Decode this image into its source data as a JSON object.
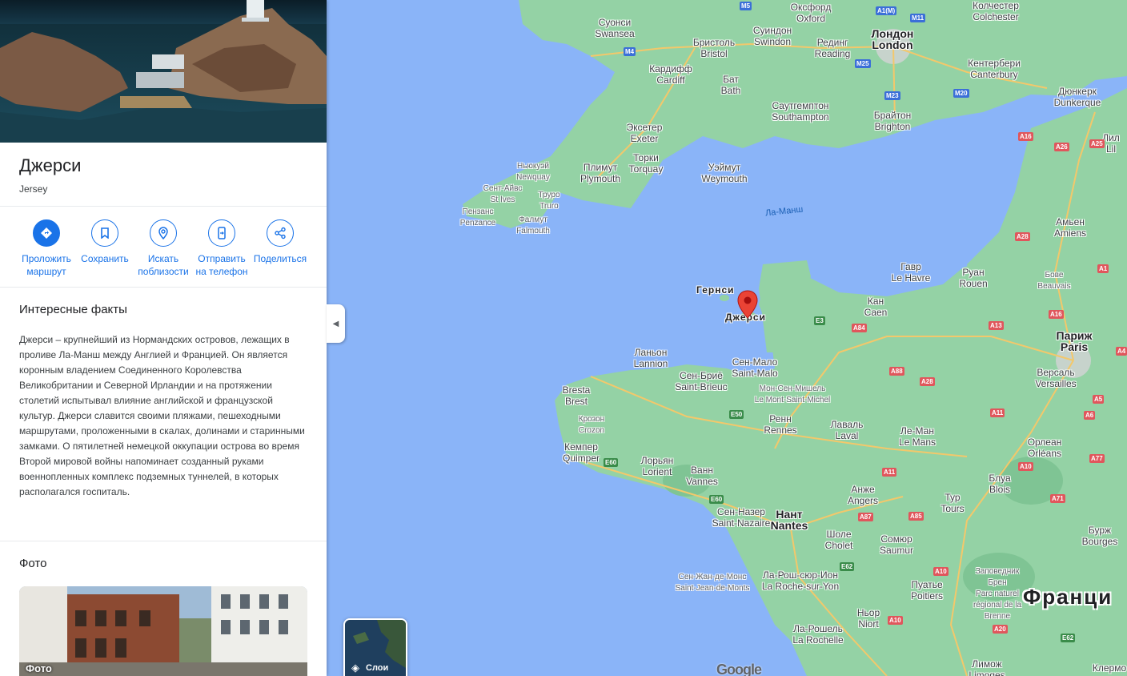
{
  "place": {
    "title": "Джерси",
    "subtitle": "Jersey"
  },
  "actions": [
    {
      "label": "Проложить маршрут",
      "icon": "directions-icon"
    },
    {
      "label": "Сохранить",
      "icon": "bookmark-icon"
    },
    {
      "label": "Искать поблизости",
      "icon": "nearby-search-icon"
    },
    {
      "label": "Отправить на телефон",
      "icon": "send-to-phone-icon"
    },
    {
      "label": "Поделиться",
      "icon": "share-icon"
    }
  ],
  "facts": {
    "title": "Интересные факты",
    "text": "Джерси – крупнейший из Нормандских островов, лежащих в проливе Ла-Манш между Англией и Францией. Он является коронным владением Соединенного Королевства Великобритании и Северной Ирландии и на протяжении столетий испытывал влияние английской и французской культур. Джерси славится своими пляжами, пешеходными маршрутами, проложенными в скалах, долинами и старинными замками. О пятилетней немецкой оккупации острова во время Второй мировой войны напоминает созданный руками военнопленных комплекс подземных туннелей, в которых располагался госпиталь."
  },
  "photos": {
    "title": "Фото",
    "card_label": "Фото"
  },
  "map": {
    "layers_label": "Слои",
    "google_logo": "Google",
    "country_label": "Франци",
    "water_label": "Ла-Манш",
    "islands": {
      "guernsey": "Гернси",
      "jersey": "Джерси"
    },
    "cities": {
      "swansea": [
        "Суонси",
        "Swansea"
      ],
      "oxford": [
        "Оксфорд",
        "Oxford"
      ],
      "colchester": [
        "Колчестер",
        "Colchester"
      ],
      "bristol": [
        "Бристоль",
        "Bristol"
      ],
      "swindon": [
        "Суиндон",
        "Swindon"
      ],
      "reading": [
        "Рединг",
        "Reading"
      ],
      "london": [
        "Лондон",
        "London"
      ],
      "cardiff": [
        "Кардифф",
        "Cardiff"
      ],
      "bath": [
        "Бат",
        "Bath"
      ],
      "canterbury": [
        "Кентербери",
        "Canterbury"
      ],
      "dunkerque": [
        "Дюнкерк",
        "Dunkerque"
      ],
      "southampton": [
        "Саутгемптон",
        "Southampton"
      ],
      "brighton": [
        "Брайтон",
        "Brighton"
      ],
      "exeter": [
        "Экcетер",
        "Exeter"
      ],
      "torquay": [
        "Торки",
        "Torquay"
      ],
      "plymouth": [
        "Плимут",
        "Plymouth"
      ],
      "weymouth": [
        "Уэймут",
        "Weymouth"
      ],
      "newquay": [
        "Ньюкуэй",
        "Newquay"
      ],
      "st_ives": [
        "Сент-Айвс",
        "St Ives"
      ],
      "truro": [
        "Труро",
        "Truro"
      ],
      "penzance": [
        "Пензанс",
        "Penzance"
      ],
      "falmouth": [
        "Фалмут",
        "Falmouth"
      ],
      "lille": [
        "Лил",
        "Lil"
      ],
      "amiens": [
        "Амьен",
        "Amiens"
      ],
      "le_havre": [
        "Гавр",
        "Le Havre"
      ],
      "rouen": [
        "Руан",
        "Rouen"
      ],
      "beauvais": [
        "Бове",
        "Beauvais"
      ],
      "caen": [
        "Кан",
        "Caen"
      ],
      "paris": [
        "Париж",
        "Paris"
      ],
      "versailles": [
        "Версаль",
        "Versailles"
      ],
      "lannion": [
        "Ланьон",
        "Lannion"
      ],
      "saint_malo": [
        "Сен-Мало",
        "Saint-Malo"
      ],
      "saint_brieuc": [
        "Сен-Бриё",
        "Saint-Brieuc"
      ],
      "mont_saint_michel": [
        "Мон-Сен-Мишель",
        "Le Mont-Saint-Michel"
      ],
      "brest": [
        "Bresta",
        "Brest"
      ],
      "crozon": [
        "Крозон",
        "Crozon"
      ],
      "rennes": [
        "Ренн",
        "Rennes"
      ],
      "laval": [
        "Лаваль",
        "Laval"
      ],
      "le_mans": [
        "Ле-Ман",
        "Le Mans"
      ],
      "quimper": [
        "Кемпер",
        "Quimper"
      ],
      "lorient": [
        "Лорьян",
        "Lorient"
      ],
      "orleans": [
        "Орлеан",
        "Orléans"
      ],
      "vannes": [
        "Ванн",
        "Vannes"
      ],
      "angers": [
        "Анже",
        "Angers"
      ],
      "blois": [
        "Блуа",
        "Blois"
      ],
      "saint_nazaire": [
        "Сен-Назер",
        "Saint-Nazaire"
      ],
      "nantes": [
        "Нант",
        "Nantes"
      ],
      "tours": [
        "Тур",
        "Tours"
      ],
      "cholet": [
        "Шоле",
        "Cholet"
      ],
      "saumur": [
        "Сомюр",
        "Saumur"
      ],
      "bourges": [
        "Бурж",
        "Bourges"
      ],
      "saint_jean_de_monts": [
        "Сен-Жан-де-Монс",
        "Saint-Jean-de-Monts"
      ],
      "la_roche_sur_yon": [
        "Ла-Рош-сюр-Ион",
        "La Roche-sur-Yon"
      ],
      "poitiers": [
        "Пуатье",
        "Poitiers"
      ],
      "brenne": [
        "Заповедник Брен",
        "Parc naturel régional de la Brenne"
      ],
      "niort": [
        "Ньор",
        "Niort"
      ],
      "la_rochelle": [
        "Ла-Рошель",
        "La Rochelle"
      ],
      "limoges": [
        "Лимож",
        "Limoges"
      ],
      "clermont": [
        "Клермо",
        ""
      ]
    },
    "roads": [
      "M5",
      "A1(M)",
      "M11",
      "M4",
      "M25",
      "M23",
      "M20",
      "A16",
      "A26",
      "A25",
      "A28",
      "A1",
      "A13",
      "A84",
      "E3",
      "A16",
      "A4",
      "A88",
      "A28",
      "A5",
      "E50",
      "A11",
      "A6",
      "A10",
      "A77",
      "A11",
      "A87",
      "E60",
      "A85",
      "A71",
      "A10",
      "E62",
      "A10",
      "E62",
      "A20",
      "E60"
    ]
  }
}
